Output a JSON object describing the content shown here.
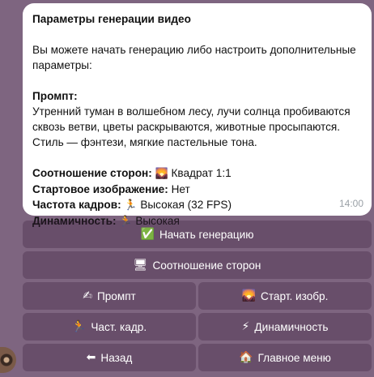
{
  "message": {
    "title": "Параметры генерации видео",
    "intro": "Вы можете начать генерацию либо настроить дополнительные параметры:",
    "prompt_label": "Промпт:",
    "prompt_text": "Утренний туман в волшебном лесу, лучи солнца пробиваются сквозь ветви, цветы раскрываются, животные просыпаются. Стиль — фэнтези, мягкие пастельные тона.",
    "params": [
      {
        "label": "Соотношение сторон:",
        "icon": "🌄",
        "value": "Квадрат 1:1"
      },
      {
        "label": "Стартовое изображение:",
        "icon": "",
        "value": "Нет"
      },
      {
        "label": "Частота кадров:",
        "icon": "🏃",
        "value": "Высокая (32 FPS)"
      },
      {
        "label": "Динамичность:",
        "icon": "🏃",
        "value": "Высокая"
      }
    ],
    "time": "14:00"
  },
  "keyboard": {
    "start": {
      "icon": "✅",
      "label": "Начать генерацию"
    },
    "aspect": {
      "icon": "🖥",
      "label": "Соотношение сторон"
    },
    "prompt": {
      "icon": "✍",
      "label": "Промпт"
    },
    "start_image": {
      "icon": "🌄",
      "label": "Старт. изобр."
    },
    "fps": {
      "icon": "🏃",
      "label": "Част. кадр."
    },
    "dynamics": {
      "icon": "⚡",
      "label": "Динамичность"
    },
    "back": {
      "icon": "⬅",
      "label": "Назад"
    },
    "home": {
      "icon": "🏠",
      "label": "Главное меню"
    }
  },
  "colors": {
    "background": "#7e6580",
    "bubble": "#ffffff",
    "button": "#5c4560"
  }
}
